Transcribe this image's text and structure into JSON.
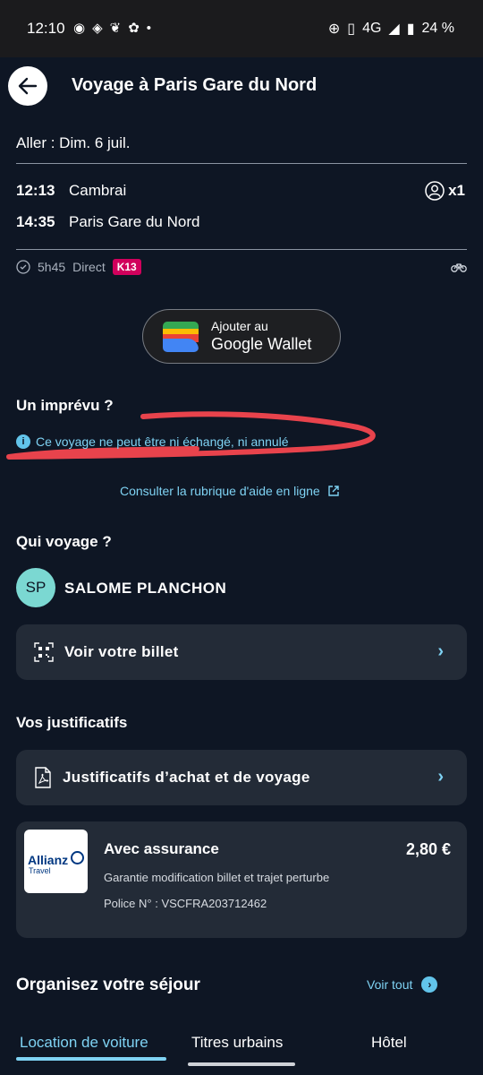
{
  "status_bar": {
    "time": "12:10",
    "network": "4G",
    "battery": "24 %",
    "notification_icons": [
      "messenger-icon",
      "messenger-alt-icon",
      "leaf-icon",
      "settings-icon",
      "dot-icon"
    ]
  },
  "header": {
    "title": "Voyage à Paris Gare du Nord"
  },
  "trip": {
    "direction": "Aller : Dim. 6 juil.",
    "departure_time": "12:13",
    "departure_station": "Cambrai",
    "arrival_time": "14:35",
    "arrival_station": "Paris Gare du Nord",
    "passengers": "x1",
    "duration": "5h45",
    "type": "Direct",
    "train_badge": "K13"
  },
  "wallet": {
    "line1": "Ajouter au",
    "line2": "Google Wallet"
  },
  "imprevu": {
    "title": "Un imprévu ?",
    "notice": "Ce voyage ne peut être ni échangé, ni annulé",
    "help_link": "Consulter la rubrique d'aide en ligne"
  },
  "traveler": {
    "title": "Qui voyage ?",
    "initials": "SP",
    "name": "SALOME PLANCHON",
    "ticket_button": "Voir votre billet"
  },
  "documents": {
    "title": "Vos justificatifs",
    "button": "Justificatifs d’achat et de voyage"
  },
  "insurance": {
    "logo_text": "Allianz",
    "logo_sub": "Travel",
    "title": "Avec assurance",
    "price": "2,80 €",
    "description": "Garantie modification billet et trajet perturbe",
    "police": "Police N° : VSCFRA203712462"
  },
  "stay": {
    "title": "Organisez votre séjour",
    "see_all": "Voir tout",
    "tabs": [
      "Location de voiture",
      "Titres urbains",
      "Hôtel"
    ]
  },
  "colors": {
    "background": "#0e1624",
    "card": "#232b37",
    "accent": "#7fd3f4",
    "badge": "#d1005c",
    "avatar": "#7bd8d2",
    "scribble": "#e8434c"
  }
}
